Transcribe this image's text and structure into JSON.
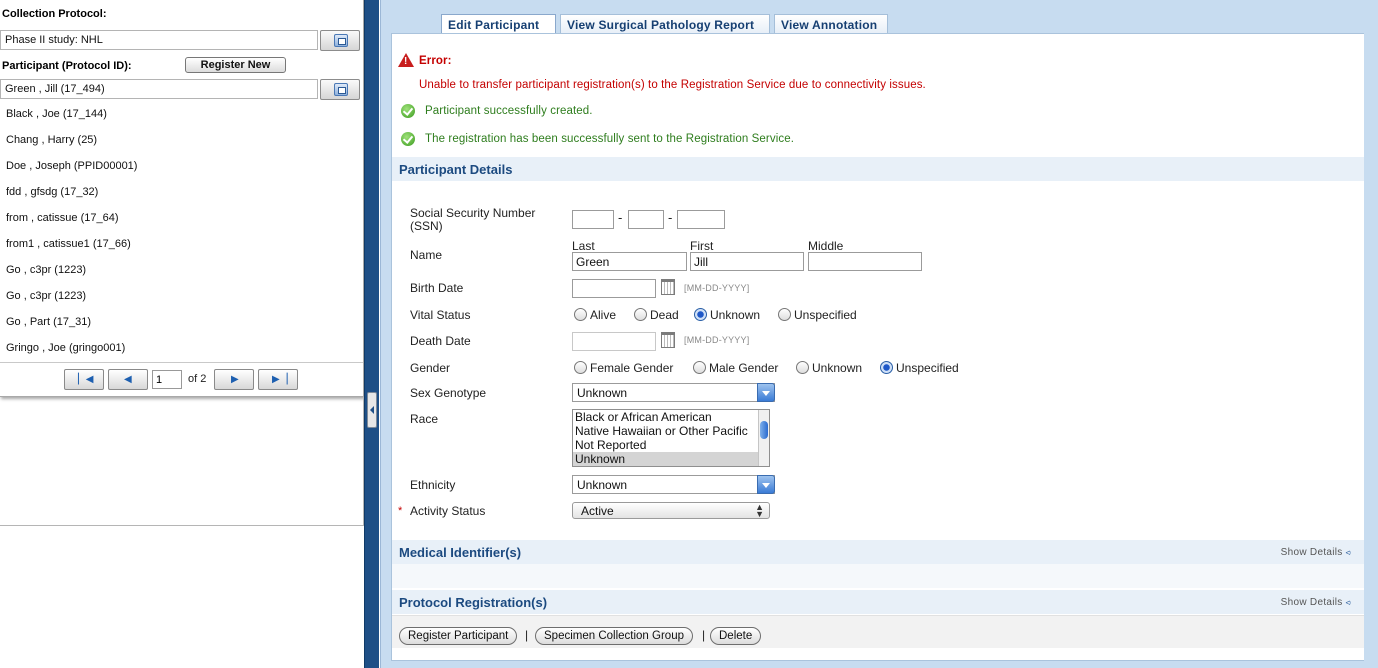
{
  "left": {
    "collection_protocol_label": "Collection Protocol:",
    "collection_protocol_value": "Phase II study: NHL",
    "participant_label": "Participant (Protocol ID):",
    "register_new": "Register New",
    "participant_value": "Green , Jill (17_494)",
    "participants": [
      "Black , Joe (17_144)",
      "Chang , Harry (25)",
      "Doe , Joseph (PPID00001)",
      "fdd , gfsdg (17_32)",
      "from , catissue (17_64)",
      "from1 , catissue1 (17_66)",
      "Go , c3pr (1223)",
      "Go , c3pr (1223)",
      "Go , Part (17_31)",
      "Gringo , Joe (gringo001)"
    ],
    "pager": {
      "page": "1",
      "of_label": "of 2"
    }
  },
  "tabs": [
    "Edit Participant",
    "View Surgical Pathology Report",
    "View Annotation"
  ],
  "messages": {
    "error_title": "Error:",
    "error_text": "Unable to transfer participant registration(s) to the Registration Service due to connectivity issues.",
    "success1": "Participant successfully created.",
    "success2": "The registration has been successfully sent to the Registration Service."
  },
  "participant_details": {
    "title": "Participant Details",
    "ssn_label": "Social Security Number (SSN)",
    "name_label": "Name",
    "last_label": "Last",
    "first_label": "First",
    "middle_label": "Middle",
    "last_value": "Green",
    "first_value": "Jill",
    "middle_value": "",
    "birth_date_label": "Birth Date",
    "date_hint": "[MM-DD-YYYY]",
    "vital_status_label": "Vital Status",
    "vital_options": [
      "Alive",
      "Dead",
      "Unknown",
      "Unspecified"
    ],
    "vital_selected": "Unknown",
    "death_date_label": "Death Date",
    "gender_label": "Gender",
    "gender_options": [
      "Female Gender",
      "Male Gender",
      "Unknown",
      "Unspecified"
    ],
    "gender_selected": "Unspecified",
    "sex_genotype_label": "Sex Genotype",
    "sex_genotype_value": "Unknown",
    "race_label": "Race",
    "race_options": [
      "Black or African American",
      "Native Hawaiian or Other Pacific",
      "Not Reported",
      "Unknown"
    ],
    "race_selected": "Unknown",
    "ethnicity_label": "Ethnicity",
    "ethnicity_value": "Unknown",
    "activity_status_label": "Activity Status",
    "activity_status_value": "Active",
    "required_mark": "*"
  },
  "medical_identifiers": {
    "title": "Medical Identifier(s)",
    "show_details": "Show Details"
  },
  "protocol_registrations": {
    "title": "Protocol Registration(s)",
    "show_details": "Show Details"
  },
  "buttons": {
    "register_participant": "Register Participant",
    "specimen_collection_group": "Specimen Collection Group",
    "delete": "Delete",
    "separator": "|"
  },
  "colors": {
    "error": "#c40000",
    "success": "#2e7d1d",
    "section_title": "#1c4a80",
    "frame": "#c7dcf0",
    "divider": "#1e4f86"
  },
  "icons": [
    "error-icon",
    "success-icon",
    "calendar-icon",
    "chevron-down-icon",
    "first-page-icon",
    "prev-page-icon",
    "next-page-icon",
    "last-page-icon",
    "lookup-icon"
  ]
}
